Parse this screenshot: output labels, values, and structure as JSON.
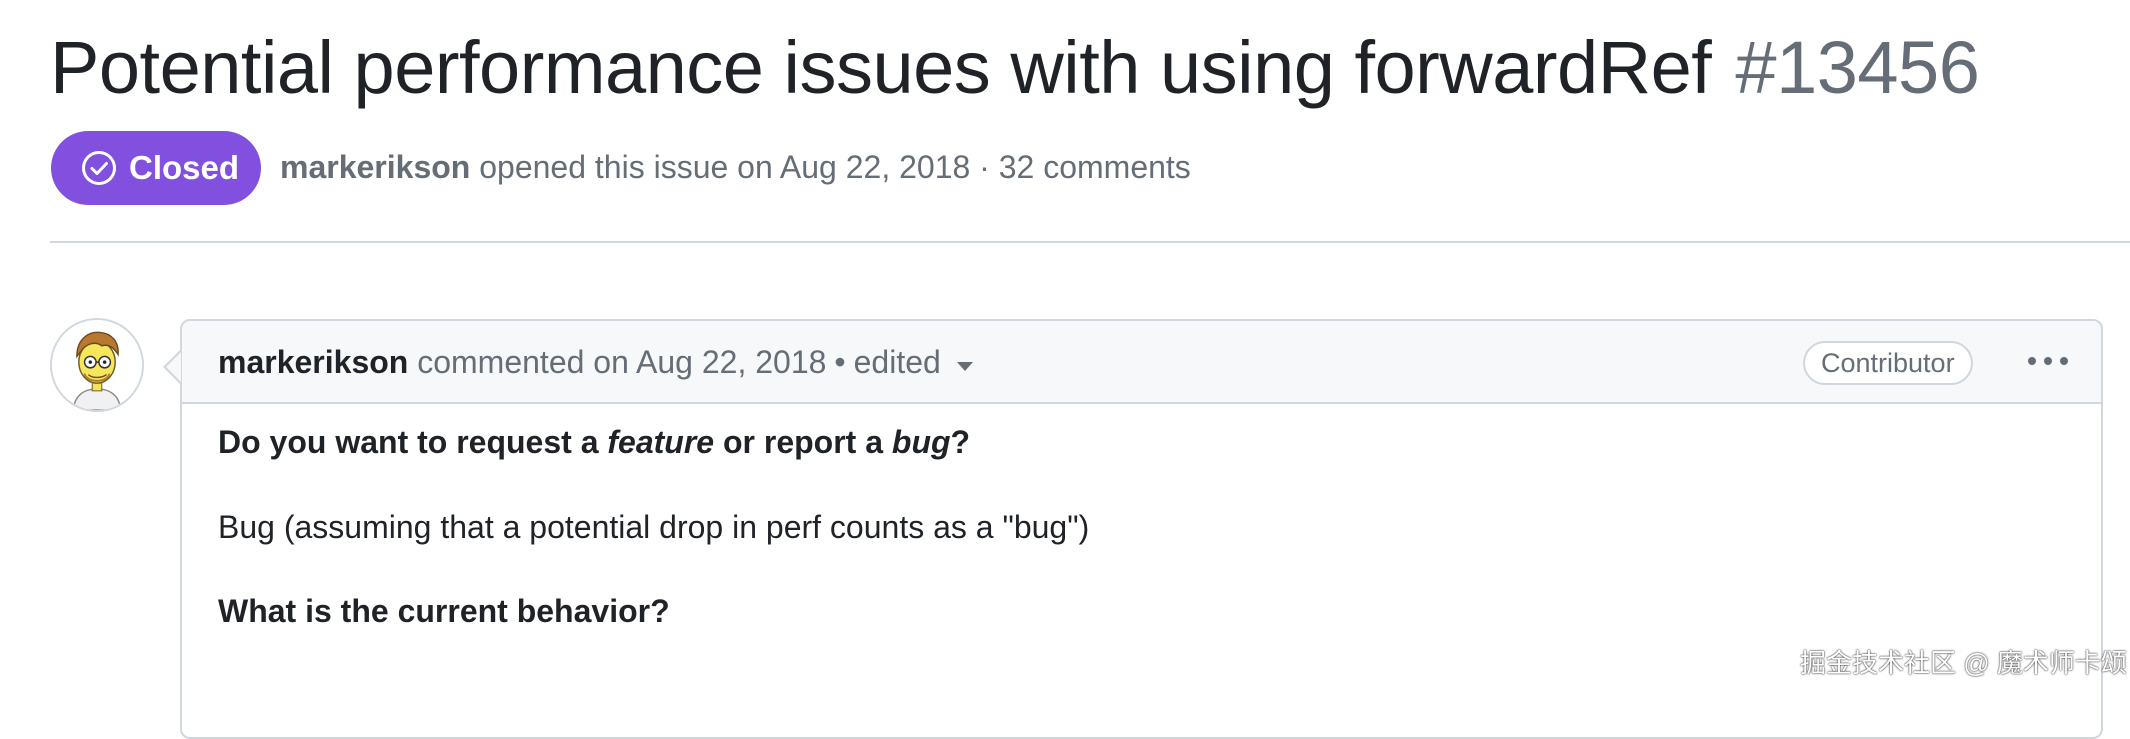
{
  "issue": {
    "title": "Potential performance issues with using forwardRef",
    "number": "#13456",
    "state_label": "Closed",
    "state_color": "#8250df",
    "author": "markerikson",
    "opened_text": "opened this issue on Aug 22, 2018 · 32 comments"
  },
  "comment": {
    "author": "markerikson",
    "commented_text": "commented on Aug 22, 2018",
    "separator": "•",
    "edited_label": "edited",
    "role_badge": "Contributor",
    "body": {
      "q1_prefix": "Do you want to request a ",
      "q1_feature": "feature",
      "q1_middle": " or report a ",
      "q1_bug": "bug",
      "q1_suffix": "?",
      "a1": "Bug (assuming that a potential drop in perf counts as a \"bug\")",
      "q2": "What is the current behavior?"
    }
  },
  "watermark": "掘金技术社区 @ 魔术师卡颂",
  "icons": {
    "state": "issue-closed-icon",
    "dropdown": "chevron-down-icon",
    "menu": "kebab-horizontal-icon",
    "avatar": "avatar"
  }
}
